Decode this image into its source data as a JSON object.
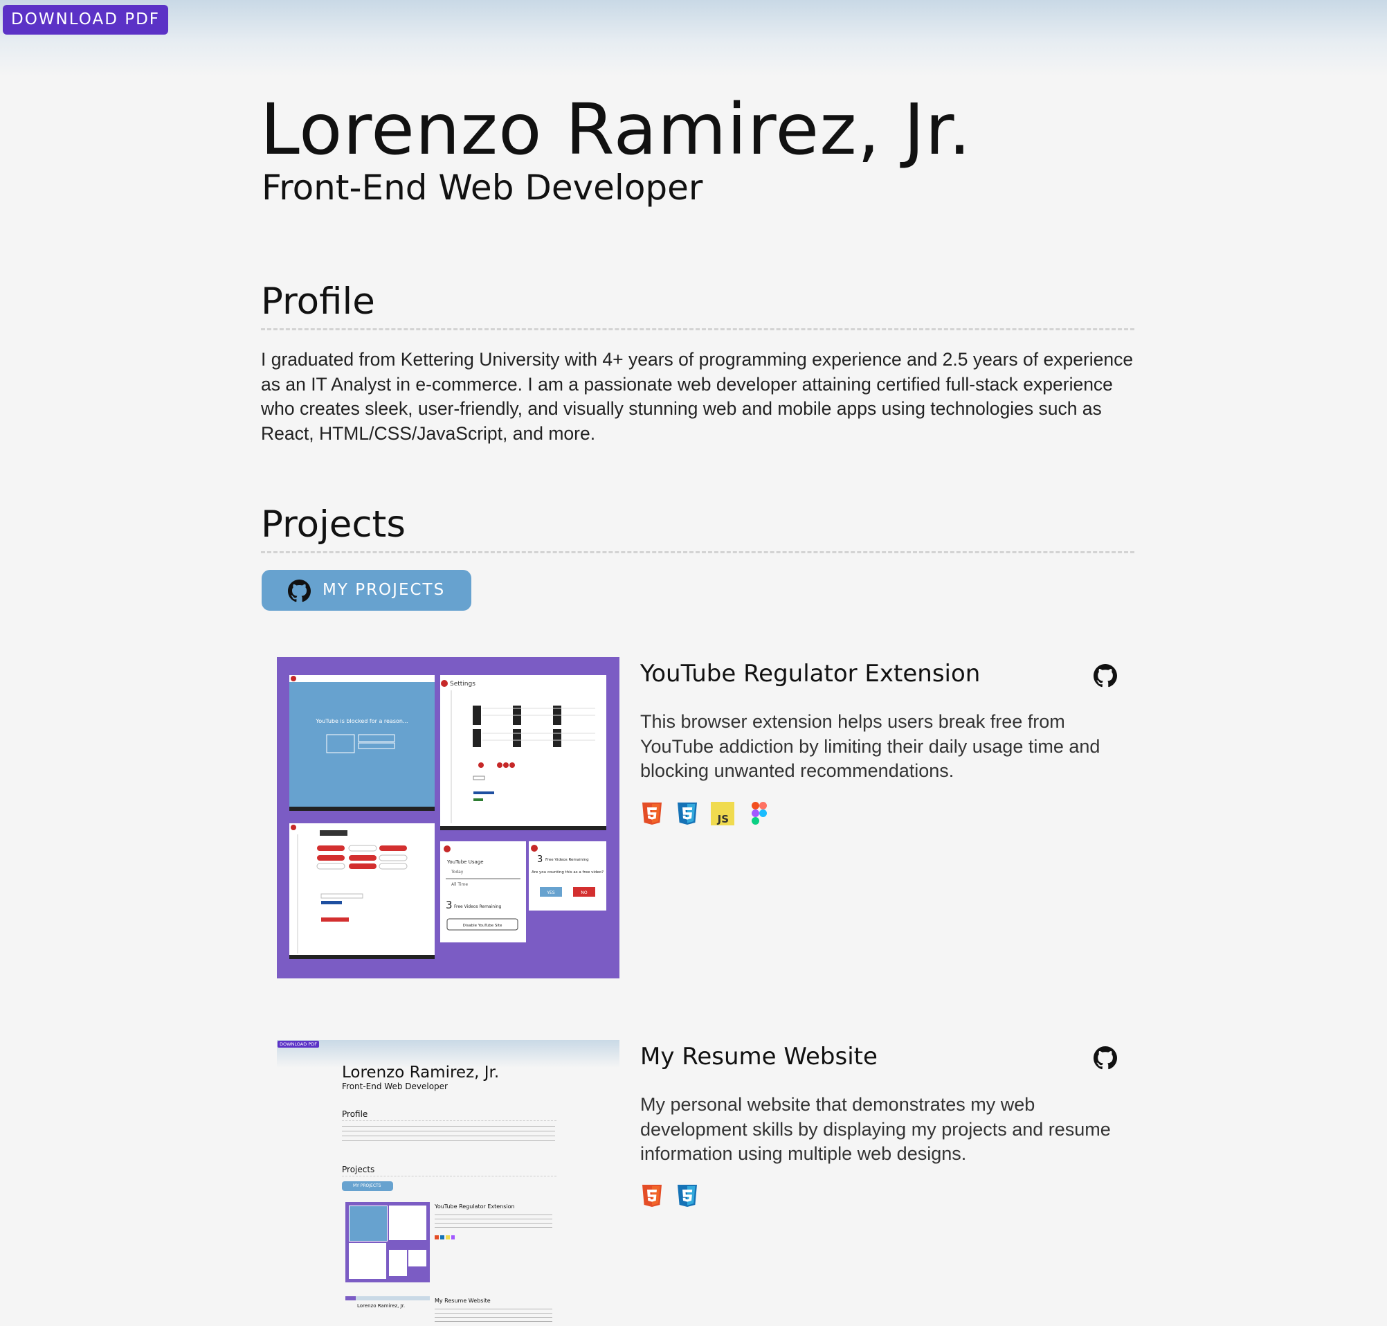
{
  "header": {
    "download_label": "DOWNLOAD PDF",
    "name": "Lorenzo Ramirez, Jr.",
    "role": "Front-End Web Developer"
  },
  "profile": {
    "heading": "Profile",
    "text": "I graduated from Kettering University with 4+ years of programming experience and 2.5 years of experience as an IT Analyst in e-commerce. I am a passionate web developer attaining certified full-stack experience who creates sleek, user-friendly, and visually stunning web and mobile apps using technologies such as React, HTML/CSS/JavaScript, and more."
  },
  "projects": {
    "heading": "Projects",
    "button_label": "MY PROJECTS",
    "items": [
      {
        "title": "YouTube Regulator Extension",
        "description": "This browser extension helps users break free from YouTube addiction by limiting their daily usage time and blocking unwanted recommendations.",
        "tech": [
          "html5-icon",
          "css3-icon",
          "javascript-icon",
          "figma-icon"
        ],
        "screens": {
          "blocked_text": "YouTube is blocked for a reason...",
          "settings_label": "Settings",
          "usage_label": "YouTube Usage",
          "today_label": "Today",
          "all_time_label": "All Time",
          "free_count": "3",
          "free_label": "Free Videos Remaining",
          "disable_label": "Disable YouTube Site",
          "question": "Are you counting this as a free video?",
          "yes_label": "YES",
          "no_label": "NO"
        }
      },
      {
        "title": "My Resume Website",
        "description": "My personal website that demonstrates my web development skills by displaying my projects and resume information using multiple web designs.",
        "tech": [
          "html5-icon",
          "css3-icon"
        ]
      }
    ]
  },
  "thumbnail": {
    "download_label": "DOWNLOAD PDF",
    "name": "Lorenzo Ramirez, Jr.",
    "role": "Front-End Web Developer",
    "profile_heading": "Profile",
    "projects_heading": "Projects",
    "projects_button": "MY PROJECTS",
    "item1_title": "YouTube Regulator Extension",
    "item2_title": "My Resume Website",
    "nested_name": "Lorenzo Ramirez, Jr."
  },
  "colors": {
    "accent_purple": "#5b32c6",
    "button_blue": "#67a2cf",
    "project_bg": "#7b5cc4"
  }
}
